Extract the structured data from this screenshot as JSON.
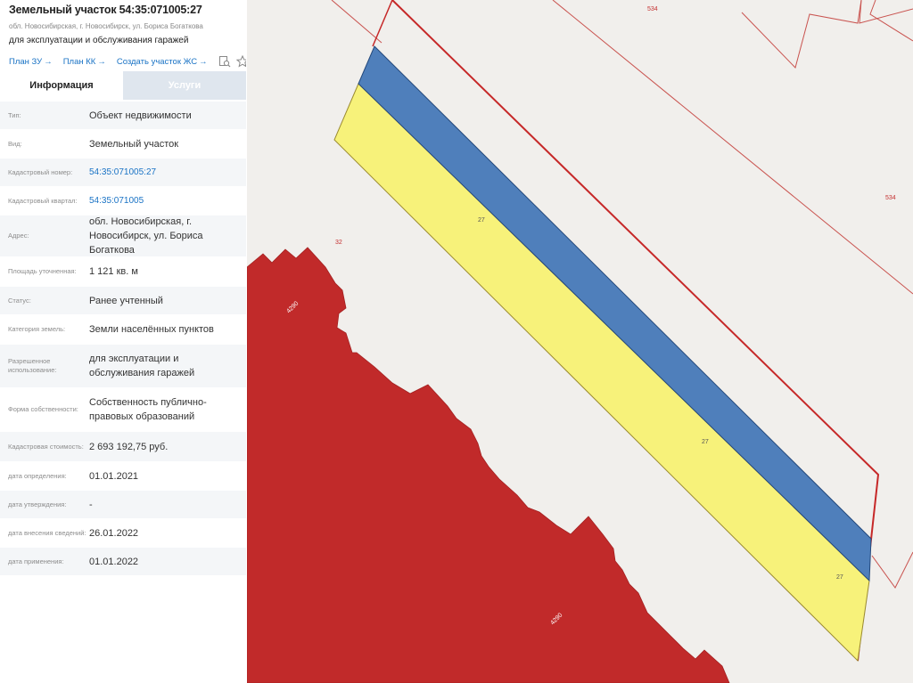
{
  "panel": {
    "title": "Земельный участок 54:35:071005:27",
    "address_short": "обл. Новосибирская, г. Новосибирск, ул. Бориса Богаткова",
    "subtitle": "для эксплуатации и обслуживания гаражей",
    "links": {
      "plan_zu": "План ЗУ",
      "plan_kk": "План КК",
      "create": "Создать участок ЖС",
      "arrow": "→"
    },
    "icons": [
      "search-doc-icon",
      "star-icon"
    ],
    "tabs": {
      "info": "Информация",
      "services": "Услуги"
    },
    "rows": [
      {
        "label": "Тип:",
        "value": "Объект недвижимости"
      },
      {
        "label": "Вид:",
        "value": "Земельный участок"
      },
      {
        "label": "Кадастровый номер:",
        "value": "54:35:071005:27"
      },
      {
        "label": "Кадастровый квартал:",
        "value": "54:35:071005"
      },
      {
        "label": "Адрес:",
        "value": "обл. Новосибирская, г. Новосибирск, ул. Бориса Богаткова"
      },
      {
        "label": "Площадь уточненная:",
        "value": "1 121 кв. м"
      },
      {
        "label": "Статус:",
        "value": "Ранее учтенный"
      },
      {
        "label": "Категория земель:",
        "value": "Земли населённых пунктов"
      },
      {
        "label": "Разрешенное использование:",
        "value": "для эксплуатации и обслуживания гаражей"
      },
      {
        "label": "Форма собственности:",
        "value": "Собственность публично-правовых образований"
      },
      {
        "label": "Кадастровая стоимость:",
        "value": "2 693 192,75 руб."
      },
      {
        "label": "дата определения:",
        "value": "01.01.2021"
      },
      {
        "label": "дата утверждения:",
        "value": "-"
      },
      {
        "label": "дата внесения сведений:",
        "value": "26.01.2022"
      },
      {
        "label": "дата применения:",
        "value": "01.01.2022"
      }
    ]
  },
  "map": {
    "labels": {
      "top_534": "534",
      "right_534": "534",
      "label_32": "32",
      "strip_27_a": "27",
      "strip_27_b": "27",
      "strip_27_c": "27",
      "red_a": "4290",
      "red_b": "4290"
    },
    "colors": {
      "background": "#f1efec",
      "yellow": "#f7f27a",
      "blue": "#4f7fbb",
      "red": "#c12a2a",
      "boundary": "#c62828"
    }
  }
}
